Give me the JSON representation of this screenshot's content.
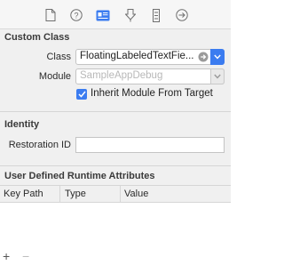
{
  "toolbar": {
    "icons": [
      "file-icon",
      "help-icon",
      "identity-icon",
      "attributes-icon",
      "size-icon",
      "connections-icon"
    ],
    "active_index": 2,
    "accent": "#3b7cf0"
  },
  "custom_class": {
    "title": "Custom Class",
    "class_label": "Class",
    "class_value": "FloatingLabeledTextFie...",
    "module_label": "Module",
    "module_placeholder": "SampleAppDebug",
    "inherit_checked": true,
    "inherit_label": "Inherit Module From Target"
  },
  "identity": {
    "title": "Identity",
    "restoration_label": "Restoration ID",
    "restoration_value": ""
  },
  "runtime_attributes": {
    "title": "User Defined Runtime Attributes",
    "columns": [
      "Key Path",
      "Type",
      "Value"
    ],
    "add_label": "+",
    "remove_label": "−"
  }
}
